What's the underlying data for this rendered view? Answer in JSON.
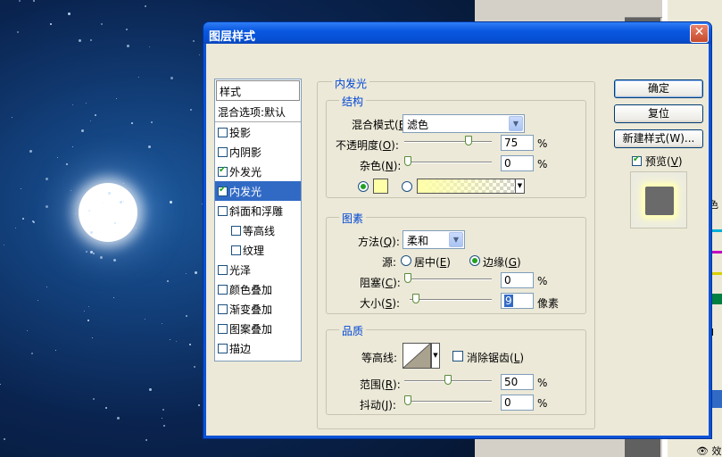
{
  "dialog": {
    "title": "图层样式",
    "close": "✕"
  },
  "style_list": {
    "header": "样式",
    "items": [
      {
        "label": "混合选项:默认",
        "checkbox": false,
        "checked": false,
        "selected": false
      },
      {
        "label": "投影",
        "checkbox": true,
        "checked": false,
        "selected": false
      },
      {
        "label": "内阴影",
        "checkbox": true,
        "checked": false,
        "selected": false
      },
      {
        "label": "外发光",
        "checkbox": true,
        "checked": true,
        "selected": false
      },
      {
        "label": "内发光",
        "checkbox": true,
        "checked": true,
        "selected": true
      },
      {
        "label": "斜面和浮雕",
        "checkbox": true,
        "checked": false,
        "selected": false
      },
      {
        "label": "等高线",
        "checkbox": true,
        "checked": false,
        "selected": false,
        "sub": true
      },
      {
        "label": "纹理",
        "checkbox": true,
        "checked": false,
        "selected": false,
        "sub": true
      },
      {
        "label": "光泽",
        "checkbox": true,
        "checked": false,
        "selected": false
      },
      {
        "label": "颜色叠加",
        "checkbox": true,
        "checked": false,
        "selected": false
      },
      {
        "label": "渐变叠加",
        "checkbox": true,
        "checked": false,
        "selected": false
      },
      {
        "label": "图案叠加",
        "checkbox": true,
        "checked": false,
        "selected": false
      },
      {
        "label": "描边",
        "checkbox": true,
        "checked": false,
        "selected": false
      }
    ]
  },
  "inner_glow": {
    "title": "内发光",
    "structure": {
      "title": "结构",
      "blend_mode_label": "混合模式",
      "blend_mode_key": "B",
      "blend_mode_value": "滤色",
      "opacity_label": "不透明度",
      "opacity_key": "O",
      "opacity_value": "75",
      "opacity_fraction": 0.75,
      "noise_label": "杂色",
      "noise_key": "N",
      "noise_value": "0",
      "noise_fraction": 0,
      "percent": "%",
      "glow_color": "#ffffa8"
    },
    "elements": {
      "title": "图素",
      "technique_label": "方法",
      "technique_key": "Q",
      "technique_value": "柔和",
      "source_label": "源:",
      "source_center": "居中",
      "source_center_key": "E",
      "source_edge": "边缘",
      "source_edge_key": "G",
      "choke_label": "阻塞",
      "choke_key": "C",
      "choke_value": "0",
      "choke_fraction": 0,
      "size_label": "大小",
      "size_key": "S",
      "size_value": "9",
      "size_fraction": 0.04,
      "size_unit": "像素",
      "percent": "%"
    },
    "quality": {
      "title": "品质",
      "contour_label": "等高线:",
      "anti_alias_label": "消除锯齿",
      "anti_alias_key": "L",
      "range_label": "范围",
      "range_key": "R",
      "range_value": "50",
      "range_fraction": 0.5,
      "jitter_label": "抖动",
      "jitter_key": "J",
      "jitter_value": "0",
      "jitter_fraction": 0,
      "percent": "%"
    }
  },
  "buttons": {
    "ok": "确定",
    "reset": "复位",
    "new_style": "新建样式(W)...",
    "preview_label": "预览",
    "preview_key": "V"
  },
  "background": {
    "side_texts": [
      "色",
      "ll",
      "效"
    ]
  }
}
